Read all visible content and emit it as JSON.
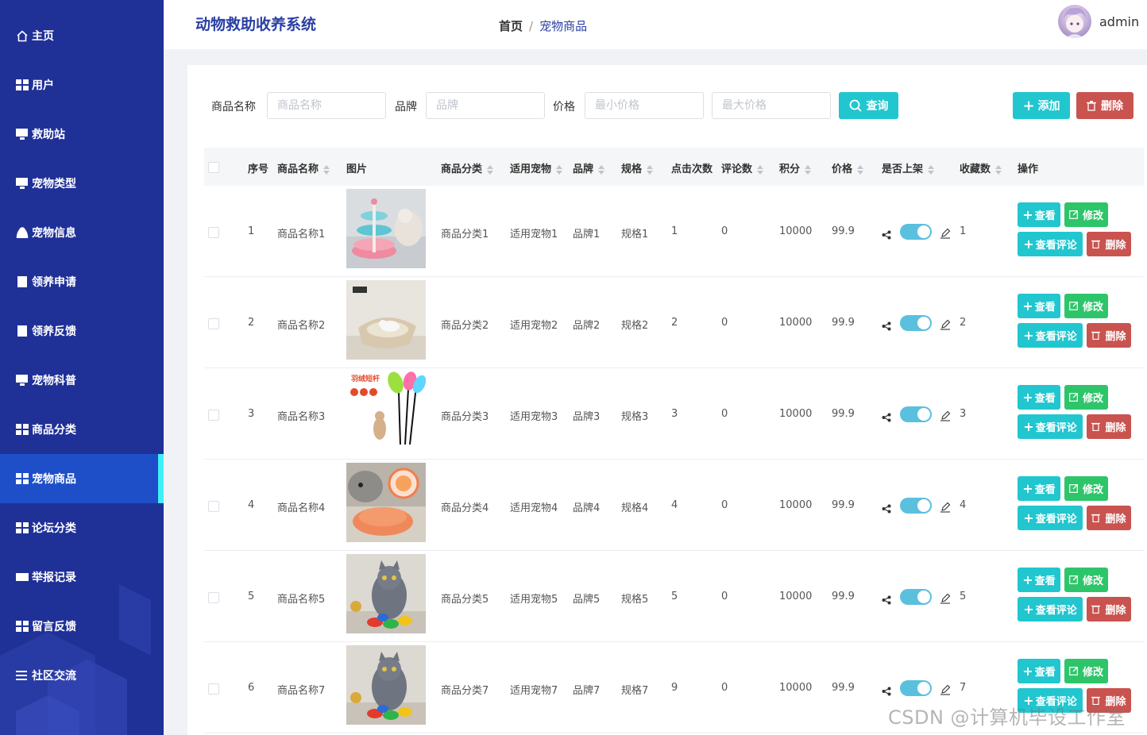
{
  "app": {
    "title": "动物救助收养系统"
  },
  "breadcrumb": {
    "home": "首页",
    "separator": "/",
    "current": "宠物商品"
  },
  "user": {
    "name": "admin"
  },
  "sidebar": {
    "items": [
      {
        "label": "主页",
        "icon": "home-icon"
      },
      {
        "label": "用户",
        "icon": "grid-icon"
      },
      {
        "label": "救助站",
        "icon": "monitor-icon"
      },
      {
        "label": "宠物类型",
        "icon": "monitor-icon"
      },
      {
        "label": "宠物信息",
        "icon": "user-icon"
      },
      {
        "label": "领养申请",
        "icon": "document-icon"
      },
      {
        "label": "领养反馈",
        "icon": "document-icon"
      },
      {
        "label": "宠物科普",
        "icon": "monitor-icon"
      },
      {
        "label": "商品分类",
        "icon": "grid-icon"
      },
      {
        "label": "宠物商品",
        "icon": "grid-icon",
        "active": true
      },
      {
        "label": "论坛分类",
        "icon": "grid-icon"
      },
      {
        "label": "举报记录",
        "icon": "ticket-icon"
      },
      {
        "label": "留言反馈",
        "icon": "grid-icon"
      },
      {
        "label": "社区交流",
        "icon": "list-icon"
      }
    ]
  },
  "search": {
    "name_label": "商品名称",
    "name_placeholder": "商品名称",
    "brand_label": "品牌",
    "brand_placeholder": "品牌",
    "price_label": "价格",
    "min_placeholder": "最小价格",
    "max_placeholder": "最大价格",
    "query_button": "查询"
  },
  "toolbar": {
    "add_label": "添加",
    "delete_label": "删除"
  },
  "table": {
    "headers": {
      "index": "序号",
      "name": "商品名称",
      "image": "图片",
      "category": "商品分类",
      "pet": "适用宠物",
      "brand": "品牌",
      "spec": "规格",
      "clicks": "点击次数",
      "comments": "评论数",
      "points": "积分",
      "price": "价格",
      "on_sale": "是否上架",
      "favorites": "收藏数",
      "actions": "操作"
    },
    "actions": {
      "view": "查看",
      "edit": "修改",
      "view_comments": "查看评论",
      "delete": "删除"
    },
    "rows": [
      {
        "index": "1",
        "name": "商品名称1",
        "category": "商品分类1",
        "pet": "适用宠物1",
        "brand": "品牌1",
        "spec": "规格1",
        "clicks": "1",
        "comments": "0",
        "points": "10000",
        "price": "99.9",
        "favorites": "1",
        "image": "cat-tower-toy"
      },
      {
        "index": "2",
        "name": "商品名称2",
        "category": "商品分类2",
        "pet": "适用宠物2",
        "brand": "品牌2",
        "spec": "规格2",
        "clicks": "2",
        "comments": "0",
        "points": "10000",
        "price": "99.9",
        "favorites": "2",
        "image": "cat-bed"
      },
      {
        "index": "3",
        "name": "商品名称3",
        "category": "商品分类3",
        "pet": "适用宠物3",
        "brand": "品牌3",
        "spec": "规格3",
        "clicks": "3",
        "comments": "0",
        "points": "10000",
        "price": "99.9",
        "favorites": "3",
        "image": "feather-wand",
        "image_text": "羽绒短杆"
      },
      {
        "index": "4",
        "name": "商品名称4",
        "category": "商品分类4",
        "pet": "适用宠物4",
        "brand": "品牌4",
        "spec": "规格4",
        "clicks": "4",
        "comments": "0",
        "points": "10000",
        "price": "99.9",
        "favorites": "4",
        "image": "ball-toy"
      },
      {
        "index": "5",
        "name": "商品名称5",
        "category": "商品分类5",
        "pet": "适用宠物5",
        "brand": "品牌5",
        "spec": "规格5",
        "clicks": "5",
        "comments": "0",
        "points": "10000",
        "price": "99.9",
        "favorites": "5",
        "image": "cat-bells"
      },
      {
        "index": "6",
        "name": "商品名称7",
        "category": "商品分类7",
        "pet": "适用宠物7",
        "brand": "品牌7",
        "spec": "规格7",
        "clicks": "9",
        "comments": "0",
        "points": "10000",
        "price": "99.9",
        "favorites": "7",
        "image": "cat-bells"
      }
    ]
  },
  "watermark": "CSDN @计算机毕设工作室",
  "colors": {
    "sidebar": "#1f3097",
    "active_item": "#1e4fc8",
    "accent": "#21c6cf",
    "danger": "#c9534f",
    "success": "#2ec56a"
  }
}
